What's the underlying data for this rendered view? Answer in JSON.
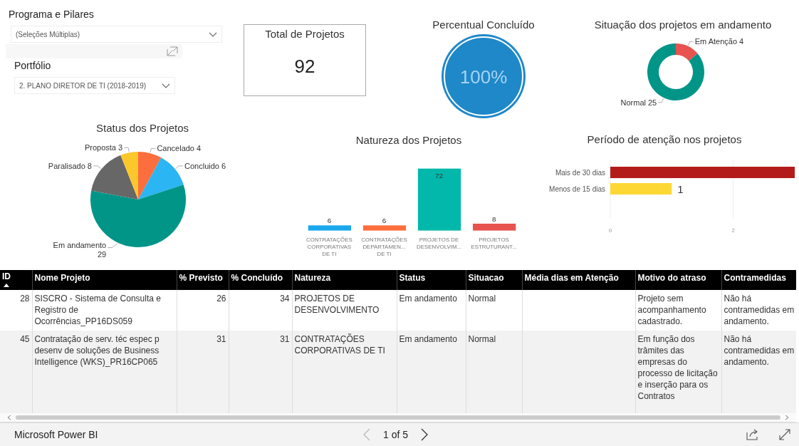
{
  "slicers": [
    {
      "label": "Programa e Pilares",
      "value": "(Seleções Múltiplas)"
    },
    {
      "label": "Portfólio",
      "value": "2. PLANO DIRETOR DE TI (2018-2019)"
    }
  ],
  "total_card": {
    "title": "Total de Projetos",
    "value": "92"
  },
  "gauge": {
    "title": "Percentual Concluído",
    "value": "100%",
    "level": 1
  },
  "situacao": {
    "title": "Situação dos projetos em andamento",
    "chart_data": {
      "type": "donut",
      "values": [
        4,
        25
      ],
      "colors": [
        "#e8524f",
        "#019588"
      ],
      "value_labels": [
        "Em Atenção 4",
        "Normal 25"
      ]
    }
  },
  "status": {
    "title": "Status dos Projetos",
    "chart_data": {
      "type": "pie",
      "values": [
        4,
        6,
        29,
        8,
        3
      ],
      "colors": [
        "#fc6e3d",
        "#2bb5f3",
        "#019588",
        "#676767",
        "#fbc72b"
      ],
      "value_labels": [
        "Cancelado 4",
        "Concluido 6",
        "Em andamento 29",
        "Paralisado 8",
        "Proposta 3"
      ]
    }
  },
  "natureza": {
    "title": "Natureza dos Projetos",
    "chart_data": {
      "type": "bar",
      "categories": [
        "CONTRATAÇÕES CORPORATIVAS DE TI",
        "CONTRATAÇÕES DEPARTAMEN... DE TI",
        "PROJETOS DE DESENVOLVIM...",
        "PROJETOS ESTRUTURANT..."
      ],
      "values": [
        6,
        6,
        72,
        8
      ],
      "colors": [
        "#1aa7ec",
        "#fc6e3d",
        "#01b8aa",
        "#e8524f"
      ],
      "value_labels": [
        "6",
        "6",
        "72",
        "8"
      ]
    }
  },
  "periodo": {
    "title": "Período de atenção nos projetos",
    "chart_data": {
      "type": "bar",
      "orientation": "horizontal",
      "categories": [
        "Mais de 30 dias",
        "Menos de 15 dias"
      ],
      "values": [
        3,
        1
      ],
      "colors": [
        "#b31b1b",
        "#fdd835"
      ],
      "xlim": [
        0,
        3
      ],
      "xticks": [
        0,
        2
      ],
      "value_labels": [
        null,
        "1"
      ]
    }
  },
  "table": {
    "columns": [
      {
        "label": "ID",
        "sorted": true
      },
      {
        "label": "Nome Projeto",
        "sorted": false
      },
      {
        "label": "% Previsto",
        "sorted": false
      },
      {
        "label": "% Concluído",
        "sorted": false
      },
      {
        "label": "Natureza",
        "sorted": false
      },
      {
        "label": "Status",
        "sorted": false
      },
      {
        "label": "Situacao",
        "sorted": false
      },
      {
        "label": "Média dias em Atenção",
        "sorted": false
      },
      {
        "label": "Motivo do atraso",
        "sorted": false
      },
      {
        "label": "Contramedidas",
        "sorted": false
      }
    ],
    "rows": [
      {
        "cells": [
          "28",
          "SISCRO - Sistema de Consulta e Registro de Ocorrências_PP16DS059",
          "26",
          "34",
          "PROJETOS DE DESENVOLVIMENTO",
          "Em andamento",
          "Normal",
          null,
          "Projeto sem acompanhamento cadastrado.",
          "Não há contramedidas em andamento."
        ]
      },
      {
        "cells": [
          "45",
          "Contratação de serv. téc espec p desenv de soluções de Business Intelligence (WKS)_PR16CP065",
          "31",
          "31",
          "CONTRATAÇÕES CORPORATIVAS DE TI",
          "Em andamento",
          "Normal",
          null,
          "Em função dos trâmites das empresas do processo de licitação e inserção para os Contratos",
          "Não há contramedidas em andamento."
        ]
      }
    ]
  },
  "footer": {
    "brand": "Microsoft Power BI",
    "page": "1 of 5"
  }
}
